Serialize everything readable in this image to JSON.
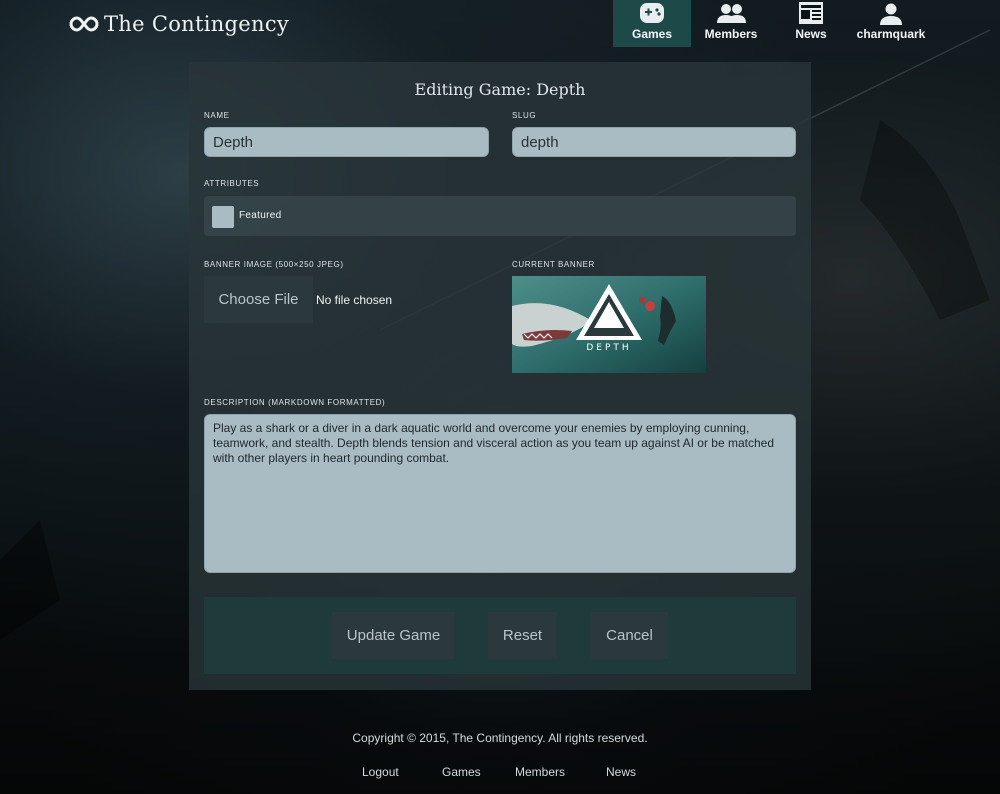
{
  "header": {
    "site_name": "The Contingency",
    "nav": [
      {
        "label": "Games",
        "icon": "gamepad-icon",
        "active": true
      },
      {
        "label": "Members",
        "icon": "people-icon",
        "active": false
      },
      {
        "label": "News",
        "icon": "newspaper-icon",
        "active": false
      },
      {
        "label": "charmquark",
        "icon": "user-icon",
        "active": false
      }
    ]
  },
  "form": {
    "title": "Editing Game: Depth",
    "name_label": "NAME",
    "name_value": "Depth",
    "slug_label": "SLUG",
    "slug_value": "depth",
    "attributes_label": "ATTRIBUTES",
    "featured_label": "Featured",
    "featured_checked": false,
    "banner_label": "BANNER IMAGE (500×250 JPEG)",
    "choose_file_label": "Choose File",
    "file_status": "No file chosen",
    "current_banner_label": "CURRENT BANNER",
    "banner_text": "DEPTH",
    "description_label": "DESCRIPTION (MARKDOWN FORMATTED)",
    "description_value": "Play as a shark or a diver in a dark aquatic world and overcome your enemies by employing cunning, teamwork, and stealth. Depth blends tension and visceral action as you team up against AI or be matched with other players in heart pounding combat.",
    "update_label": "Update Game",
    "reset_label": "Reset",
    "cancel_label": "Cancel"
  },
  "footer": {
    "copyright": "Copyright © 2015, The Contingency. All rights reserved.",
    "links": [
      "Logout",
      "Games",
      "Members",
      "News"
    ]
  },
  "colors": {
    "accent": "#1d4a48",
    "field_bg": "#a9bcc4",
    "card_bg": "#28343a",
    "button_bg": "#2b383c"
  }
}
